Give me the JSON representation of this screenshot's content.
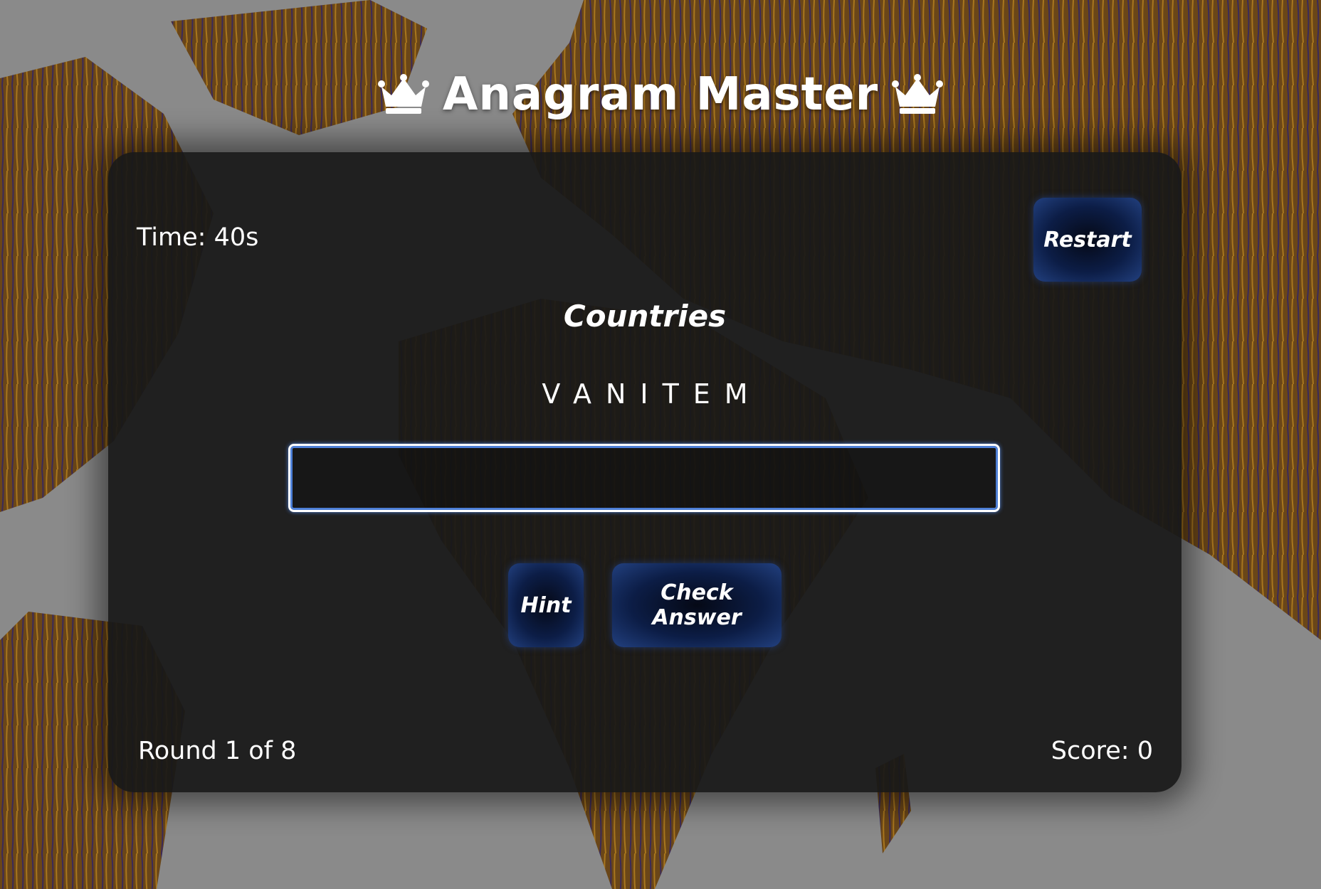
{
  "header": {
    "title": "Anagram Master"
  },
  "game": {
    "timer": "Time: 40s",
    "restart_label": "Restart",
    "category": "Countries",
    "scrambled_word": "VANITEM",
    "answer_value": "",
    "hint_label": "Hint",
    "check_label": "Check Answer",
    "round": "Round 1 of 8",
    "score": "Score: 0"
  },
  "icons": {
    "title_left": "crown-icon",
    "title_right": "crown-icon"
  },
  "colors": {
    "button_accent": "#1e3a78",
    "input_border": "#4d7fd6",
    "map_land": "#6b4a1e"
  }
}
